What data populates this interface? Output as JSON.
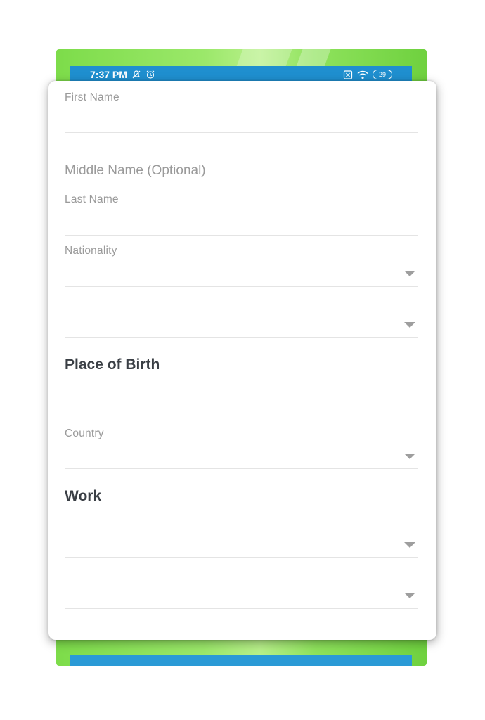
{
  "status_bar": {
    "time": "7:37 PM",
    "battery": "29",
    "icons": [
      "notifications-off-icon",
      "alarm-icon",
      "sim-off-icon",
      "wifi-icon",
      "battery-icon"
    ]
  },
  "form": {
    "first_name": {
      "label": "First Name",
      "value": ""
    },
    "middle_name": {
      "placeholder": "Middle Name (Optional)",
      "value": ""
    },
    "last_name": {
      "label": "Last Name",
      "value": ""
    },
    "nationality": {
      "label": "Nationality",
      "value": ""
    },
    "second_dropdown": {
      "value": ""
    },
    "place_of_birth": {
      "title": "Place of Birth",
      "input_value": "",
      "country": {
        "label": "Country",
        "value": ""
      }
    },
    "work": {
      "title": "Work",
      "dropdown_1": {
        "value": ""
      },
      "dropdown_2": {
        "value": ""
      }
    }
  },
  "colors": {
    "status_bar": "#1f8fcf",
    "background_green": "#7ddc4a",
    "label_gray": "#9a9a9a",
    "title_dark": "#3a3f45",
    "divider": "#e4e4e4"
  }
}
